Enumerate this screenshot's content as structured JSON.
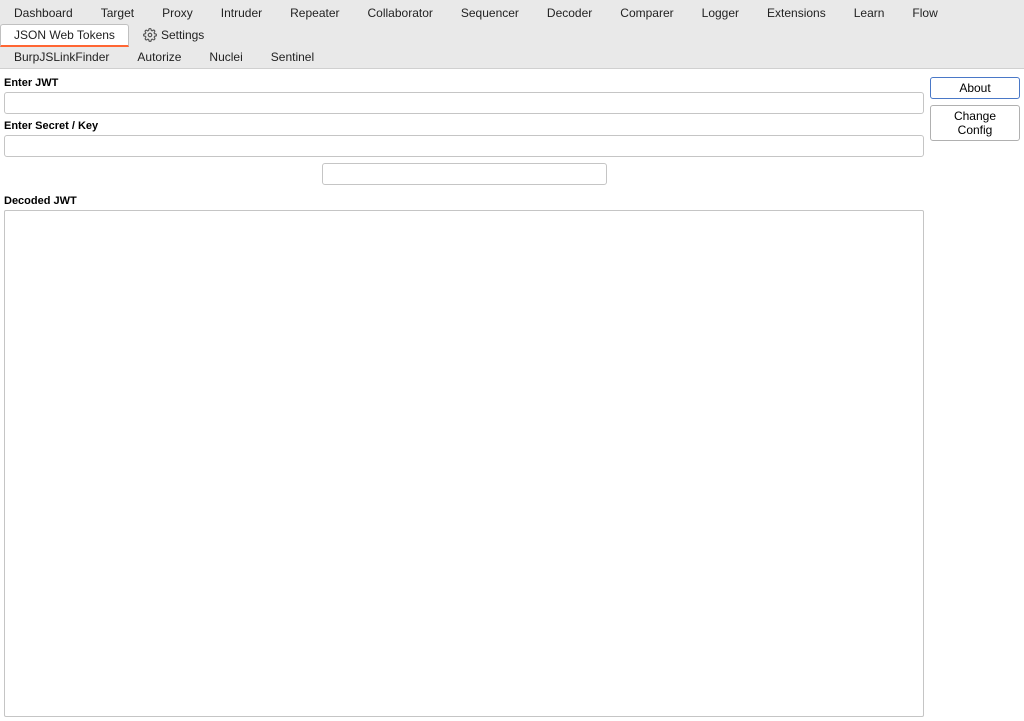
{
  "tabs_row1": [
    {
      "label": "Dashboard",
      "name": "tab-dashboard"
    },
    {
      "label": "Target",
      "name": "tab-target"
    },
    {
      "label": "Proxy",
      "name": "tab-proxy"
    },
    {
      "label": "Intruder",
      "name": "tab-intruder"
    },
    {
      "label": "Repeater",
      "name": "tab-repeater"
    },
    {
      "label": "Collaborator",
      "name": "tab-collaborator"
    },
    {
      "label": "Sequencer",
      "name": "tab-sequencer"
    },
    {
      "label": "Decoder",
      "name": "tab-decoder"
    },
    {
      "label": "Comparer",
      "name": "tab-comparer"
    },
    {
      "label": "Logger",
      "name": "tab-logger"
    },
    {
      "label": "Extensions",
      "name": "tab-extensions"
    },
    {
      "label": "Learn",
      "name": "tab-learn"
    },
    {
      "label": "Flow",
      "name": "tab-flow"
    },
    {
      "label": "JSON Web Tokens",
      "name": "tab-json-web-tokens",
      "active": true
    }
  ],
  "settings_label": "Settings",
  "tabs_row2": [
    {
      "label": "BurpJSLinkFinder",
      "name": "tab-burpjslinkfinder"
    },
    {
      "label": "Autorize",
      "name": "tab-autorize"
    },
    {
      "label": "Nuclei",
      "name": "tab-nuclei"
    },
    {
      "label": "Sentinel",
      "name": "tab-sentinel"
    }
  ],
  "labels": {
    "enter_jwt": "Enter JWT",
    "enter_secret": "Enter Secret / Key",
    "decoded_jwt": "Decoded JWT"
  },
  "buttons": {
    "about": "About",
    "change_config": "Change Config"
  },
  "inputs": {
    "jwt_value": "",
    "secret_value": "",
    "extra_value": ""
  }
}
